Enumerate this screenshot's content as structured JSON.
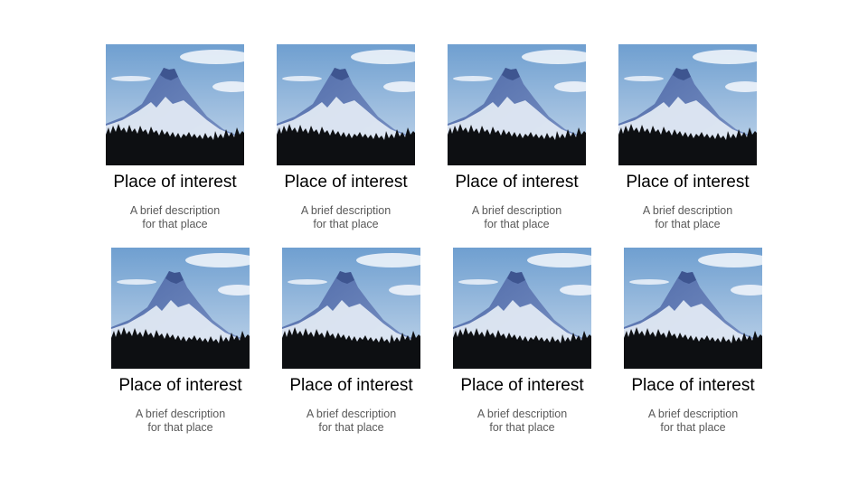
{
  "cards": [
    {
      "title": "Place of interest",
      "desc_line1": "A brief description",
      "desc_line2": "for that place"
    },
    {
      "title": "Place of interest",
      "desc_line1": "A brief description",
      "desc_line2": "for that place"
    },
    {
      "title": "Place of interest",
      "desc_line1": "A brief description",
      "desc_line2": "for that place"
    },
    {
      "title": "Place of interest",
      "desc_line1": "A brief description",
      "desc_line2": "for that place"
    },
    {
      "title": "Place of interest",
      "desc_line1": "A brief description",
      "desc_line2": "for that place"
    },
    {
      "title": "Place of interest",
      "desc_line1": "A brief description",
      "desc_line2": "for that place"
    },
    {
      "title": "Place of interest",
      "desc_line1": "A brief description",
      "desc_line2": "for that place"
    },
    {
      "title": "Place of interest",
      "desc_line1": "A brief description",
      "desc_line2": "for that place"
    }
  ],
  "photo_icon": "mountain-photo-icon",
  "colors": {
    "sky_top": "#6f9fd0",
    "sky_bottom": "#c3d7ea",
    "mountain": "#5f7bb7",
    "snow": "#e6edf7",
    "forest": "#0d0f12",
    "title_text": "#000000",
    "desc_text": "#595959"
  }
}
